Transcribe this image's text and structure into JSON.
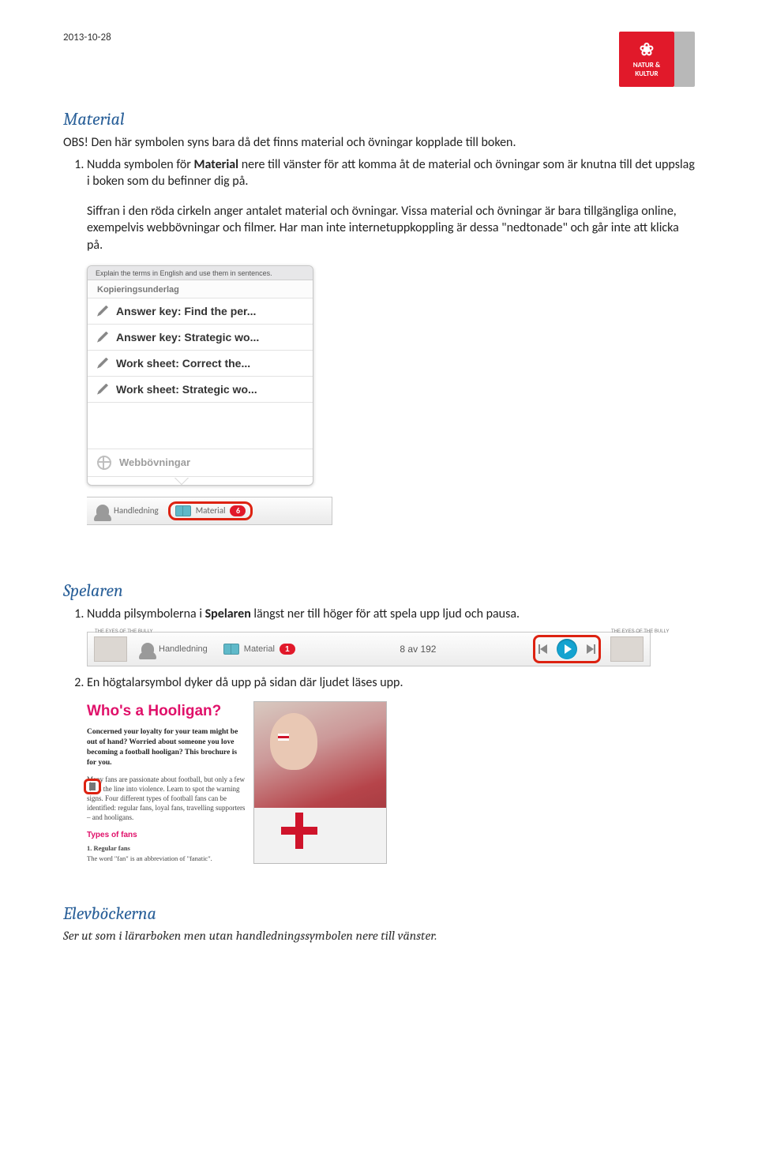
{
  "header": {
    "date": "2013-10-28",
    "brand_line1": "NATUR &",
    "brand_line2": "KULTUR"
  },
  "sections": {
    "material": {
      "heading": "Material",
      "intro": "OBS! Den här symbolen syns bara då det finns material och övningar kopplade till boken.",
      "step1_pre": "Nudda symbolen för ",
      "step1_bold": "Material",
      "step1_post": " nere till vänster för att komma åt de material och övningar som är knutna till det uppslag i boken som du befinner dig på.",
      "para2": "Siffran i den röda cirkeln anger antalet material och övningar. Vissa material och övningar är bara tillgängliga online, exempelvis webbövningar och filmer. Har man inte internetuppkoppling är dessa \"nedtonade\" och går inte att klicka på."
    },
    "spelaren": {
      "heading": "Spelaren",
      "step1_pre": "Nudda pilsymbolerna i ",
      "step1_bold": "Spelaren",
      "step1_post": " längst ner till höger för att spela upp ljud och pausa.",
      "step2": "En högtalarsymbol dyker då upp på sidan där ljudet läses upp."
    },
    "elev": {
      "heading": "Elevböckerna",
      "sub": "Ser ut som i lärarboken men utan handledningssymbolen nere till vänster."
    }
  },
  "popup": {
    "topbar": "Explain the terms in English and use them in sentences.",
    "section_label": "Kopieringsunderlag",
    "items": [
      "Answer key: Find the per...",
      "Answer key: Strategic wo...",
      "Work sheet: Correct the...",
      "Work sheet: Strategic wo..."
    ],
    "web_label": "Webbövningar",
    "foot_handledning": "Handledning",
    "foot_material": "Material",
    "badge": "6"
  },
  "player": {
    "caption": "THE EYES OF THE BULLY",
    "caption2": "THE EYES OF THE BULLY",
    "handledning": "Handledning",
    "material": "Material",
    "material_badge": "1",
    "counter": "8 av 192"
  },
  "article": {
    "title": "Who's a Hooligan?",
    "lead": "Concerned your loyalty for your team might be out of hand? Worried about someone you love becoming a football hooligan? This brochure is for you.",
    "body": "Many fans are passionate about football, but only a few cross the line into violence. Learn to spot the warning signs. Four different types of football fans can be identified: regular fans, loyal fans, travelling supporters – and hooligans.",
    "types": "Types of fans",
    "reg": "1. Regular fans",
    "last": "The word \"fan\" is an abbreviation of \"fanatic\"."
  }
}
